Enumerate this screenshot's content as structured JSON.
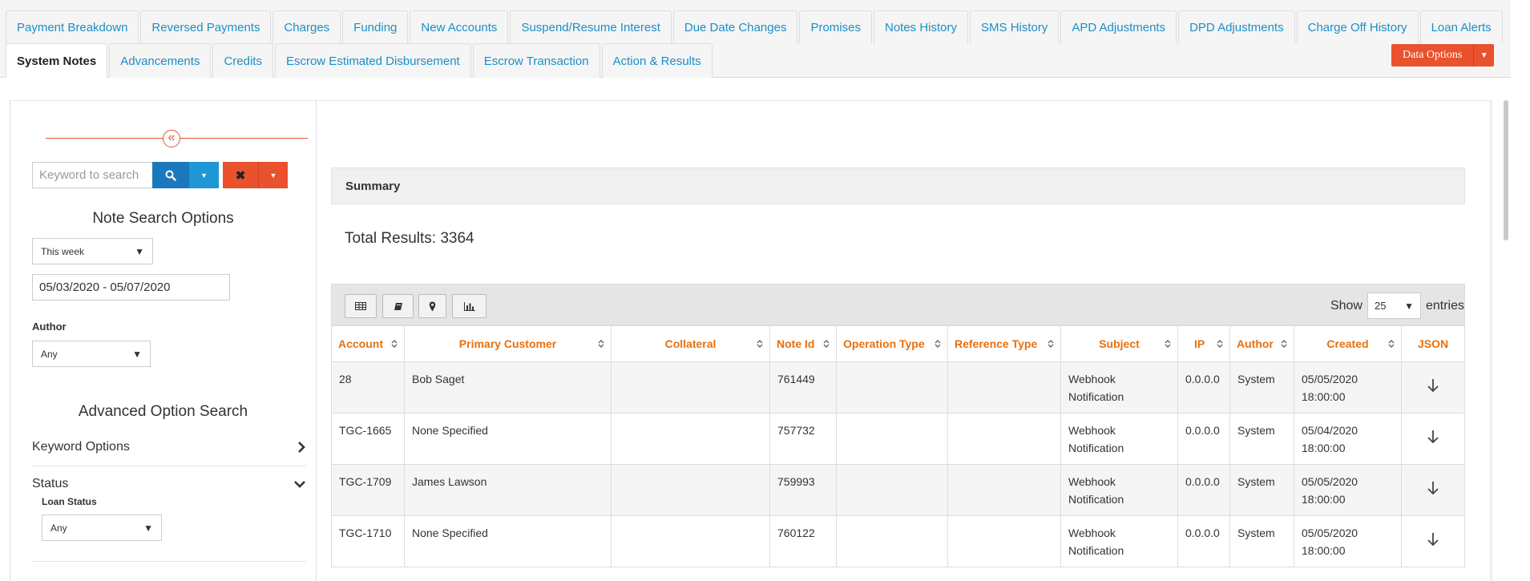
{
  "tabs_row1": [
    {
      "label": "Payment Breakdown"
    },
    {
      "label": "Reversed Payments"
    },
    {
      "label": "Charges"
    },
    {
      "label": "Funding"
    },
    {
      "label": "New Accounts"
    },
    {
      "label": "Suspend/Resume Interest"
    },
    {
      "label": "Due Date Changes"
    },
    {
      "label": "Promises"
    },
    {
      "label": "Notes History"
    },
    {
      "label": "SMS History"
    },
    {
      "label": "APD Adjustments"
    },
    {
      "label": "DPD Adjustments"
    },
    {
      "label": "Charge Off History"
    },
    {
      "label": "Loan Alerts"
    }
  ],
  "tabs_row2": [
    {
      "label": "System Notes",
      "active": true
    },
    {
      "label": "Advancements"
    },
    {
      "label": "Credits"
    },
    {
      "label": "Escrow Estimated Disbursement"
    },
    {
      "label": "Escrow Transaction"
    },
    {
      "label": "Action & Results"
    }
  ],
  "data_options": {
    "label": "Data Options"
  },
  "sidebar": {
    "search": {
      "placeholder": "Keyword to search",
      "value": ""
    },
    "note_search_heading": "Note Search Options",
    "period_select": "This week",
    "date_range": "05/03/2020 - 05/07/2020",
    "author_label": "Author",
    "author_select": "Any",
    "advanced_heading": "Advanced Option Search",
    "keyword_options_label": "Keyword Options",
    "status_label": "Status",
    "loan_status_label": "Loan Status",
    "loan_status_select": "Any"
  },
  "main": {
    "summary_label": "Summary",
    "total_results": "Total Results: 3364",
    "show_label": "Show",
    "entries_value": "25",
    "entries_label": "entries"
  },
  "table": {
    "columns": [
      "Account",
      "Primary Customer",
      "Collateral",
      "Note Id",
      "Operation Type",
      "Reference Type",
      "Subject",
      "IP",
      "Author",
      "Created",
      "JSON"
    ],
    "rows": [
      {
        "account": "28",
        "customer": "Bob Saget",
        "collateral": "",
        "note_id": "761449",
        "operation_type": "",
        "reference_type": "",
        "subject_1": "Webhook",
        "subject_2": "Notification",
        "ip": "0.0.0.0",
        "author": "System",
        "created_date": "05/05/2020",
        "created_time": "18:00:00"
      },
      {
        "account": "TGC-1665",
        "customer": "None Specified",
        "collateral": "",
        "note_id": "757732",
        "operation_type": "",
        "reference_type": "",
        "subject_1": "Webhook",
        "subject_2": "Notification",
        "ip": "0.0.0.0",
        "author": "System",
        "created_date": "05/04/2020",
        "created_time": "18:00:00"
      },
      {
        "account": "TGC-1709",
        "customer": "James Lawson",
        "collateral": "",
        "note_id": "759993",
        "operation_type": "",
        "reference_type": "",
        "subject_1": "Webhook",
        "subject_2": "Notification",
        "ip": "0.0.0.0",
        "author": "System",
        "created_date": "05/05/2020",
        "created_time": "18:00:00"
      },
      {
        "account": "TGC-1710",
        "customer": "None Specified",
        "collateral": "",
        "note_id": "760122",
        "operation_type": "",
        "reference_type": "",
        "subject_1": "Webhook",
        "subject_2": "Notification",
        "ip": "0.0.0.0",
        "author": "System",
        "created_date": "05/05/2020",
        "created_time": "18:00:00"
      }
    ]
  },
  "colors": {
    "link_blue": "#1a8fc7",
    "accent_orange": "#e9522d",
    "header_orange": "#e8700d",
    "search_blue": "#1b78bd"
  }
}
